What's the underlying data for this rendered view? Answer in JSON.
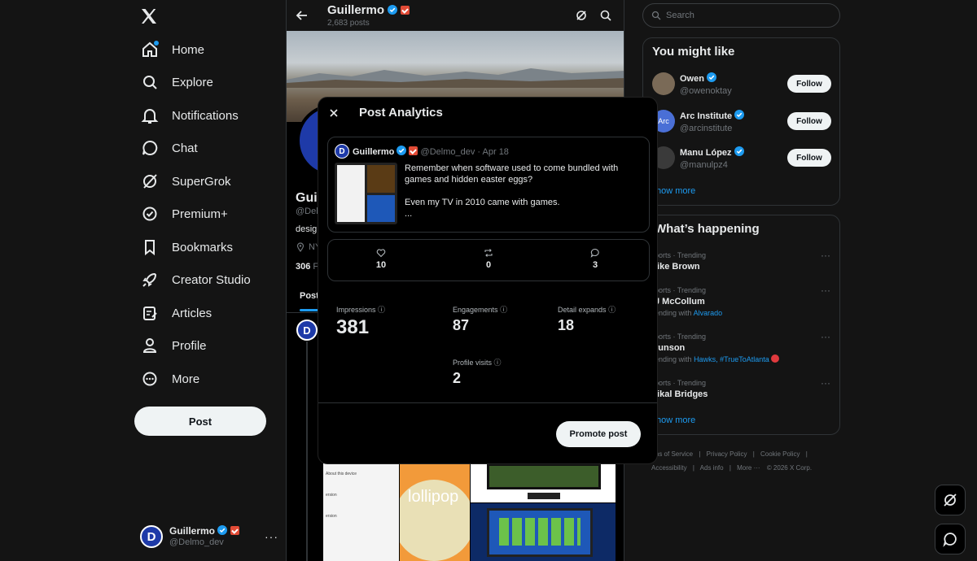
{
  "nav": {
    "items": [
      {
        "label": "Home",
        "icon": "home-icon"
      },
      {
        "label": "Explore",
        "icon": "search-icon"
      },
      {
        "label": "Notifications",
        "icon": "bell-icon"
      },
      {
        "label": "Chat",
        "icon": "chat-icon"
      },
      {
        "label": "SuperGrok",
        "icon": "grok-icon"
      },
      {
        "label": "Premium+",
        "icon": "premium-icon"
      },
      {
        "label": "Bookmarks",
        "icon": "bookmark-icon"
      },
      {
        "label": "Creator Studio",
        "icon": "rocket-icon"
      },
      {
        "label": "Articles",
        "icon": "articles-icon"
      },
      {
        "label": "Profile",
        "icon": "person-icon"
      },
      {
        "label": "More",
        "icon": "more-circle-icon"
      }
    ],
    "post_label": "Post"
  },
  "account": {
    "name": "Guillermo",
    "handle": "@Delmo_dev",
    "initial": "D"
  },
  "profile": {
    "name": "Guillermo",
    "posts_count": "2,683 posts",
    "name_partial": "Guil",
    "handle_partial": "@Delr",
    "bio_partial": "design",
    "location_partial": "NY",
    "following_partial": "306",
    "following_suffix": "Fo",
    "tab_partial": "Post"
  },
  "search": {
    "placeholder": "Search"
  },
  "might_like": {
    "title": "You might like",
    "follow_label": "Follow",
    "users": [
      {
        "name": "Owen",
        "handle": "@owenoktay"
      },
      {
        "name": "Arc Institute",
        "handle": "@arcinstitute"
      },
      {
        "name": "Manu López",
        "handle": "@manulpz4"
      }
    ],
    "show_more": "how more"
  },
  "happening": {
    "title": "What’s happening",
    "items": [
      {
        "meta": "ports · Trending",
        "title": "like Brown",
        "sub": "",
        "links": ""
      },
      {
        "meta": "ports · Trending",
        "title": "J McCollum",
        "sub": "ending with",
        "links": "Alvarado"
      },
      {
        "meta": "ports · Trending",
        "title": "runson",
        "sub": "ending with",
        "links": "Hawks, #TrueToAtlanta"
      },
      {
        "meta": "ports · Trending",
        "title": "likal Bridges",
        "sub": "",
        "links": ""
      }
    ],
    "show_more": "how more"
  },
  "footer": {
    "row1": [
      "rms of Service",
      "Privacy Policy",
      "Cookie Policy"
    ],
    "row2": [
      "Accessibility",
      "Ads info",
      "More ···",
      "© 2026 X Corp."
    ]
  },
  "modal": {
    "title": "Post Analytics",
    "tweet": {
      "author": "Guillermo",
      "handle": "@Delmo_dev",
      "date": "· Apr 18",
      "line1": "Remember when software used to come bundled with",
      "line2": "games and hidden easter eggs?",
      "line3": "Even my TV in 2010 came with games.",
      "ellipsis": "..."
    },
    "stats": {
      "likes": "10",
      "reposts": "0",
      "replies": "3"
    },
    "metrics": {
      "impressions_label": "Impressions",
      "impressions": "381",
      "engagements_label": "Engagements",
      "engagements": "87",
      "detail_label": "Detail expands",
      "detail": "18",
      "profile_label": "Profile visits",
      "profile": "2"
    },
    "promote_label": "Promote post"
  },
  "media": {
    "lollipop_text": "lollipop",
    "settings_lines": [
      "About this device",
      "ersion",
      "ersion",
      "ersion"
    ]
  },
  "colors": {
    "accent": "#1d9bf0",
    "badge": "#e24b36",
    "bg": "#141414"
  }
}
